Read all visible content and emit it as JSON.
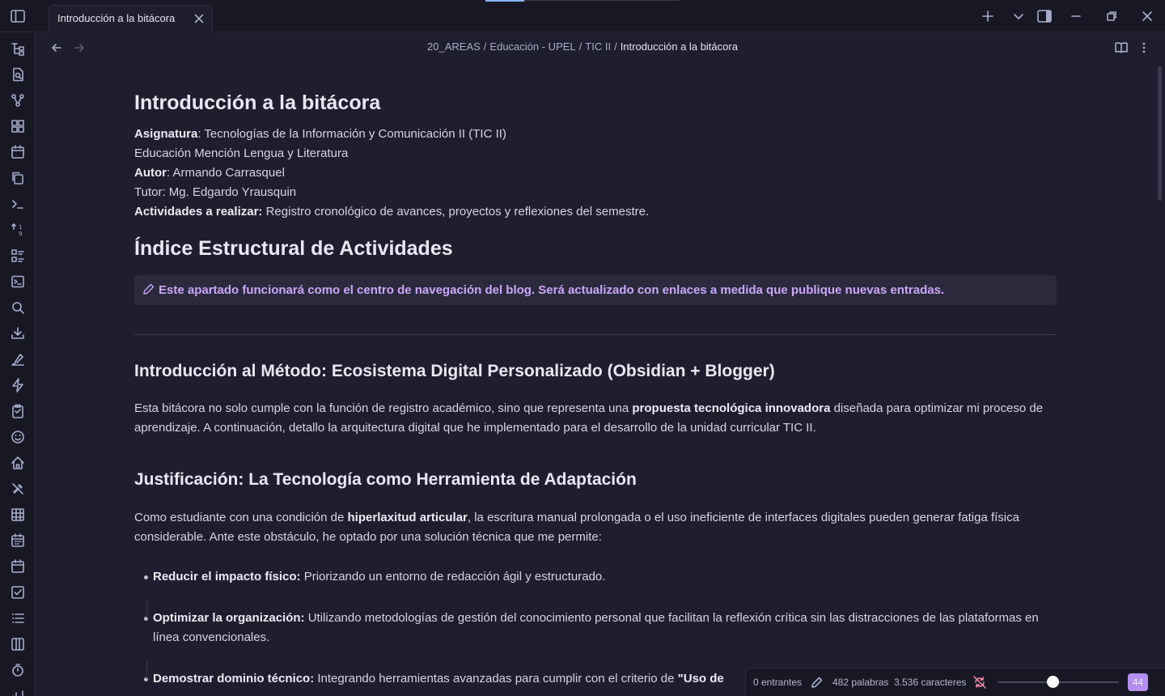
{
  "colors": {
    "accent": "#cba6f7",
    "background": "#1e1e2e",
    "chrome": "#181825"
  },
  "tab": {
    "title": "Introducción a la bitácora"
  },
  "breadcrumb": {
    "items": [
      "20_AREAS",
      "Educación - UPEL",
      "TIC II"
    ],
    "current": "Introducción a la bitácora",
    "separator": "/"
  },
  "note": {
    "title": "Introducción a la bitácora",
    "meta": [
      {
        "label": "Asignatura",
        "text": ": Tecnologías de la Información y Comunicación II (TIC II)"
      },
      {
        "label": "",
        "text": "Educación Mención Lengua y Literatura"
      },
      {
        "label": "Autor",
        "text": ": Armando Carrasquel"
      },
      {
        "label": "",
        "text": "Tutor: Mg. Edgardo Yrausquin"
      },
      {
        "label": "Actividades a realizar:",
        "text": " Registro cronológico de avances, proyectos y reflexiones del semestre."
      }
    ],
    "index_heading": "Índice Estructural de Actividades",
    "callout": "Este apartado funcionará como el centro de navegación del blog. Será actualizado con enlaces a medida que publique nuevas entradas.",
    "method_heading": "Introducción al Método: Ecosistema Digital Personalizado (Obsidian + Blogger)",
    "method_para": {
      "before": "Esta bitácora no solo cumple con la función de registro académico, sino que representa una ",
      "bold": "propuesta tecnológica innovadora",
      "after": " diseñada para optimizar mi proceso de aprendizaje. A continuación, detallo la arquitectura digital que he implementado para el desarrollo de la unidad curricular TIC II."
    },
    "justification_heading": "Justificación: La Tecnología como Herramienta de Adaptación",
    "justification_para": {
      "before": "Como estudiante con una condición de ",
      "bold": "hiperlaxitud articular",
      "after": ", la escritura manual prolongada o el uso ineficiente de interfaces digitales pueden generar fatiga física considerable. Ante este obstáculo, he optado por una solución técnica que me permite:"
    },
    "bullets": [
      {
        "label": "Reducir el impacto físico:",
        "text": " Priorizando un entorno de redacción ágil y estructurado."
      },
      {
        "label": "Optimizar la organización:",
        "text": " Utilizando metodologías de gestión del conocimiento personal que facilitan la reflexión crítica sin las distracciones de las plataformas en línea convencionales."
      },
      {
        "label": "Demostrar dominio técnico:",
        "text": " Integrando herramientas avanzadas para cumplir con el criterio de ",
        "tail_bold": "\"Uso de"
      }
    ]
  },
  "status": {
    "backlinks": "0 entrantes",
    "words": "482 palabras",
    "chars": "3.536 caracteres",
    "zoom_value": "44",
    "zoom_level": 0.45
  },
  "icons": {
    "ribbon": [
      "files-icon",
      "search-file-icon",
      "graph-icon",
      "grid-icon",
      "calendar-icon",
      "copy-icon",
      "terminal-icon",
      "sort-icon",
      "list-icon",
      "console-icon",
      "search-icon",
      "download-icon",
      "brush-icon",
      "lightning-icon",
      "clipboard-icon",
      "smile-icon",
      "home-icon",
      "tools-icon",
      "table-icon",
      "calendar-grid-icon",
      "calendar-day-icon",
      "checkbox-icon",
      "list-ordered-icon",
      "columns-icon",
      "timer-icon",
      "chart-icon"
    ]
  }
}
